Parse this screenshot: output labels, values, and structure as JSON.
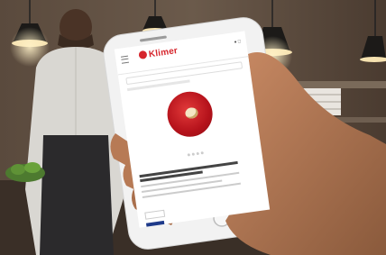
{
  "app": {
    "logo_text": "Klimer"
  },
  "colors": {
    "brand_red": "#d6252c",
    "button_blue": "#1e3a8a"
  },
  "icons": [
    "menu-icon",
    "cart-icon",
    "user-icon",
    "search-icon"
  ]
}
